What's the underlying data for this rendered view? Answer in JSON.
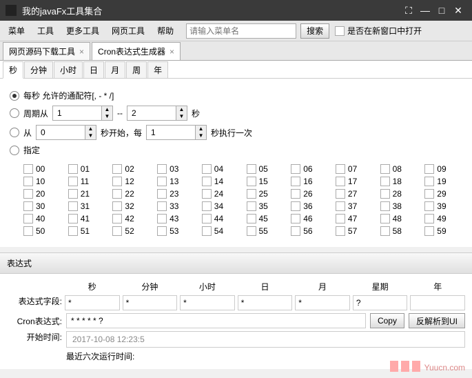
{
  "window": {
    "title": "我的javaFx工具集合"
  },
  "menubar": {
    "items": [
      "菜单",
      "工具",
      "更多工具",
      "网页工具",
      "帮助"
    ],
    "search_placeholder": "请输入菜单名",
    "search_btn": "搜索",
    "newwin_label": "是否在新窗口中打开"
  },
  "tabs": [
    {
      "label": "网页源码下载工具",
      "closable": true
    },
    {
      "label": "Cron表达式生成器",
      "closable": true,
      "active": true
    }
  ],
  "subtabs": [
    "秒",
    "分钟",
    "小时",
    "日",
    "月",
    "周",
    "年"
  ],
  "subtab_active": 0,
  "options": {
    "opt1": "每秒 允许的通配符[, - * /]",
    "opt2_a": "周期从",
    "opt2_v1": "1",
    "opt2_mid": "--",
    "opt2_v2": "2",
    "opt2_b": "秒",
    "opt3_a": "从",
    "opt3_v1": "0",
    "opt3_mid": "秒开始，每",
    "opt3_v2": "1",
    "opt3_b": "秒执行一次",
    "opt4": "指定",
    "selected": 0
  },
  "seconds": [
    "00",
    "01",
    "02",
    "03",
    "04",
    "05",
    "06",
    "07",
    "08",
    "09",
    "10",
    "11",
    "12",
    "13",
    "14",
    "15",
    "16",
    "17",
    "18",
    "19",
    "20",
    "21",
    "22",
    "23",
    "24",
    "25",
    "26",
    "27",
    "28",
    "29",
    "30",
    "31",
    "32",
    "33",
    "34",
    "35",
    "36",
    "37",
    "38",
    "39",
    "40",
    "41",
    "42",
    "43",
    "44",
    "45",
    "46",
    "47",
    "48",
    "49",
    "50",
    "51",
    "52",
    "53",
    "54",
    "55",
    "56",
    "57",
    "58",
    "59"
  ],
  "expr": {
    "section_title": "表达式",
    "headers": [
      "秒",
      "分钟",
      "小时",
      "日",
      "月",
      "星期",
      "年"
    ],
    "field_label": "表达式字段:",
    "fields": [
      "*",
      "*",
      "*",
      "*",
      "*",
      "?",
      ""
    ],
    "cron_label": "Cron表达式:",
    "cron_value": "* * * * * ?",
    "copy_btn": "Copy",
    "parse_btn": "反解析到UI",
    "start_label": "开始时间:",
    "start_value": "2017-10-08 12:23:5",
    "recent_label": "最近六次运行时间:"
  },
  "watermark": "Yuucn.com"
}
